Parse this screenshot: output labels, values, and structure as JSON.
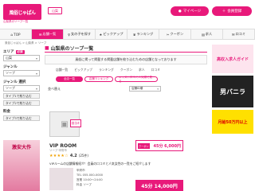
{
  "header": {
    "logo": "風俗じゃぱん",
    "logo_sub": "山梨県のソープ一覧",
    "region": "山梨",
    "mypage": "マイページ",
    "register": "会員登録"
  },
  "nav": [
    {
      "label": "TOP",
      "icon": "home-icon"
    },
    {
      "label": "店舗一覧",
      "icon": "list-icon",
      "active": true
    },
    {
      "label": "女の子を探す",
      "icon": "person-icon"
    },
    {
      "label": "ピックアップ",
      "icon": "star-icon"
    },
    {
      "label": "ランキング",
      "icon": "crown-icon"
    },
    {
      "label": "クーポン",
      "icon": "ticket-icon"
    },
    {
      "label": "求人",
      "icon": "briefcase-icon"
    },
    {
      "label": "口コミ",
      "icon": "chat-icon"
    }
  ],
  "breadcrumb": "風俗じゃぱん > 山梨県 > ソープ",
  "sidebar": {
    "area_label": "エリア",
    "area_tag": "必須",
    "area_value": "山梨",
    "genre_label": "ジャンル",
    "genre_value": "ソープ",
    "genre2_label": "ジャンル 選択",
    "genre2_value": "ソープ",
    "chips": [
      "タイプ1で絞り込む",
      "タイプ2で絞り込む",
      "タイプ3で絞り込む"
    ],
    "price_label": "料金",
    "ad_text": "激安大作"
  },
  "main": {
    "title": "山梨県のソープ一覧",
    "notice": "風俗に掲って掲載する掲載店舗を絞り込むための店舗となっております",
    "tabs": [
      "店舗一覧",
      "ピックアップ",
      "ランキング",
      "クーポン",
      "求人",
      "口コミ"
    ],
    "pill_all": "全店一覧",
    "pill_ranking": "店舗ランキング",
    "pill_review": "キャスト口コミ人気順で見る",
    "sort_label": "並べ替え",
    "sort_value": "店舗ID順"
  },
  "shop": {
    "badge": "口コミ",
    "name": "VIP ROOM",
    "sub": "ソープ 甲府市",
    "stars": "★★★★☆",
    "rating": "4.2",
    "reviews": "(25件)",
    "desc": "VIPルームの店舗情報紹介！会員の口コミと人気女性の一覧をご紹介します",
    "info_lines": [
      "甲府市",
      "TEL 055-000-0000",
      "営業 10:00〜24:00",
      "料金 ソープ"
    ],
    "coupon_tag": "クーポン",
    "coupon_price": "45分 6,000円",
    "big_price": "45分 14,000円"
  },
  "right": {
    "banner1": "高収入求人ガイド",
    "banner2": "男バニラ",
    "banner3": "月給50万円以上"
  }
}
